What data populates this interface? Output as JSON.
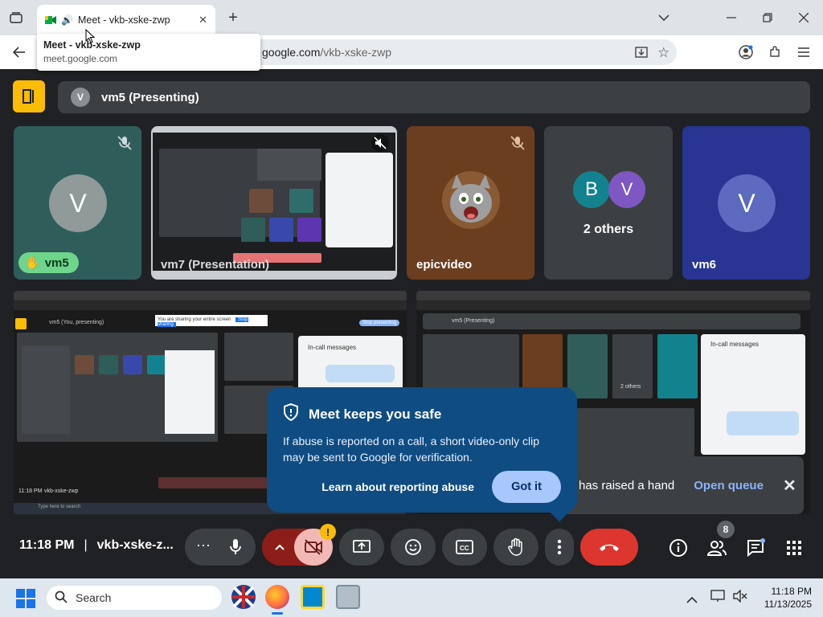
{
  "browser": {
    "tab_title": "Meet - vkb-xske-zwp",
    "tooltip_title": "Meet - vkb-xske-zwp",
    "tooltip_url": "meet.google.com",
    "url_host": "google.com",
    "url_path": "/vkb-xske-zwp"
  },
  "meet": {
    "presenter_initial": "V",
    "presenter_label": "vm5 (Presenting)",
    "tiles": [
      {
        "name": "vm5",
        "initial": "V",
        "color": "#5f6368"
      },
      {
        "name": "vm7 (Presentation)"
      },
      {
        "name": "epicvideo"
      },
      {
        "name": "2 others",
        "initials": [
          "B",
          "V"
        ]
      },
      {
        "name": "vm6",
        "initial": "V",
        "color": "#5c6bc0"
      }
    ],
    "thumb_texts": {
      "left_title": "vm5 (You, presenting)",
      "left_stop": "Stop presenting",
      "left_share": "You are sharing your entire screen",
      "left_stopsharing": "Stop sharing",
      "left_chat": "In-call messages",
      "left_taskbar_time": "11:18 PM",
      "left_taskbar_code": "vkb-xske-zwp",
      "left_taskbar_search": "Type here to search",
      "right_title": "vm5 (Presenting)",
      "right_chat": "In-call messages",
      "right_others": "2 others",
      "right_epic": "epicvideo"
    },
    "toast": {
      "title": "Meet keeps you safe",
      "body": "If abuse is reported on a call, a short video-only clip may be sent to Google for verification.",
      "link": "Learn about reporting abuse",
      "button": "Got it"
    },
    "hand_bar": {
      "text": "has raised a hand",
      "link": "Open queue"
    },
    "controls": {
      "time": "11:18 PM",
      "separator": "|",
      "meeting_code": "vkb-xske-z...",
      "participants_count": "8",
      "alert_badge": "!"
    },
    "colors": {
      "end_call": "#dc362e",
      "hand": "#6dd58c",
      "accent": "#8ab4f8",
      "logo": "#fbbc04"
    }
  },
  "taskbar": {
    "search_placeholder": "Search",
    "time": "11:18 PM",
    "date": "11/13/2025"
  }
}
